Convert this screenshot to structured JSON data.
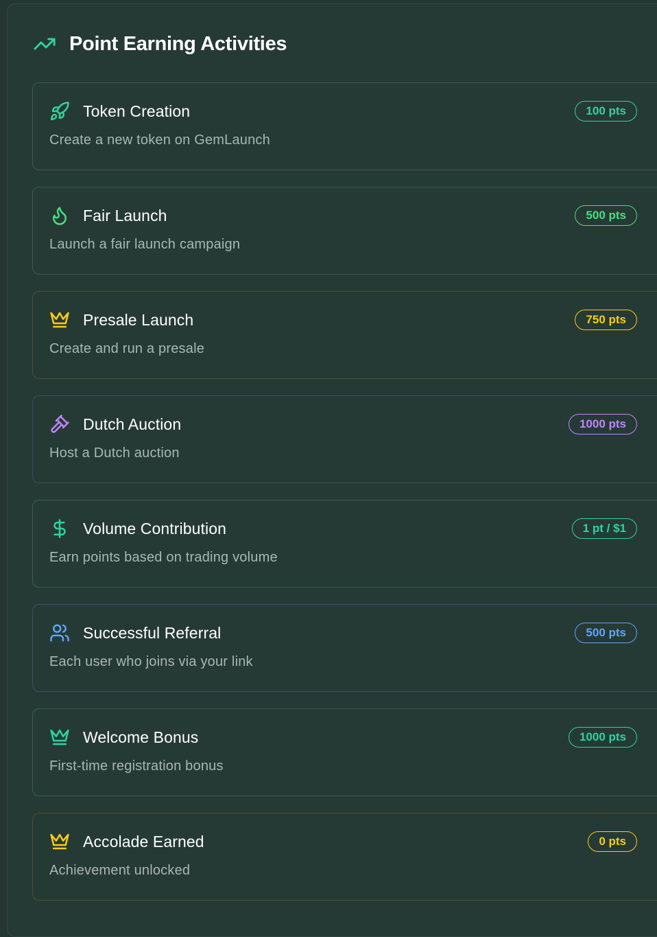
{
  "header": {
    "title": "Point Earning Activities",
    "icon": "trending-up-icon",
    "color": "#2dd4a3"
  },
  "activities": [
    {
      "title": "Token Creation",
      "description": "Create a new token on GemLaunch",
      "points": "100 pts",
      "icon": "rocket-icon",
      "color": "#34d399",
      "border": "#385a50"
    },
    {
      "title": "Fair Launch",
      "description": "Launch a fair launch campaign",
      "points": "500 pts",
      "icon": "flame-icon",
      "color": "#4ade80",
      "border": "#385a47"
    },
    {
      "title": "Presale Launch",
      "description": "Create and run a presale",
      "points": "750 pts",
      "icon": "crown-icon",
      "color": "#facc15",
      "border": "#4e4d2e"
    },
    {
      "title": "Dutch Auction",
      "description": "Host a Dutch auction",
      "points": "1000 pts",
      "icon": "gavel-icon",
      "color": "#c084fc",
      "border": "#414860"
    },
    {
      "title": "Volume Contribution",
      "description": "Earn points based on trading volume",
      "points": "1 pt / $1",
      "icon": "dollar-icon",
      "color": "#2dd4a3",
      "border": "#385a50"
    },
    {
      "title": "Successful Referral",
      "description": "Each user who joins via your link",
      "points": "500 pts",
      "icon": "users-icon",
      "color": "#60a5fa",
      "border": "#39506a"
    },
    {
      "title": "Welcome Bonus",
      "description": "First-time registration bonus",
      "points": "1000 pts",
      "icon": "crown-icon",
      "color": "#2dd4a3",
      "border": "#385a50"
    },
    {
      "title": "Accolade Earned",
      "description": "Achievement unlocked",
      "points": "0 pts",
      "icon": "crown-icon",
      "color": "#facc15",
      "border": "#4e4d2e"
    }
  ]
}
